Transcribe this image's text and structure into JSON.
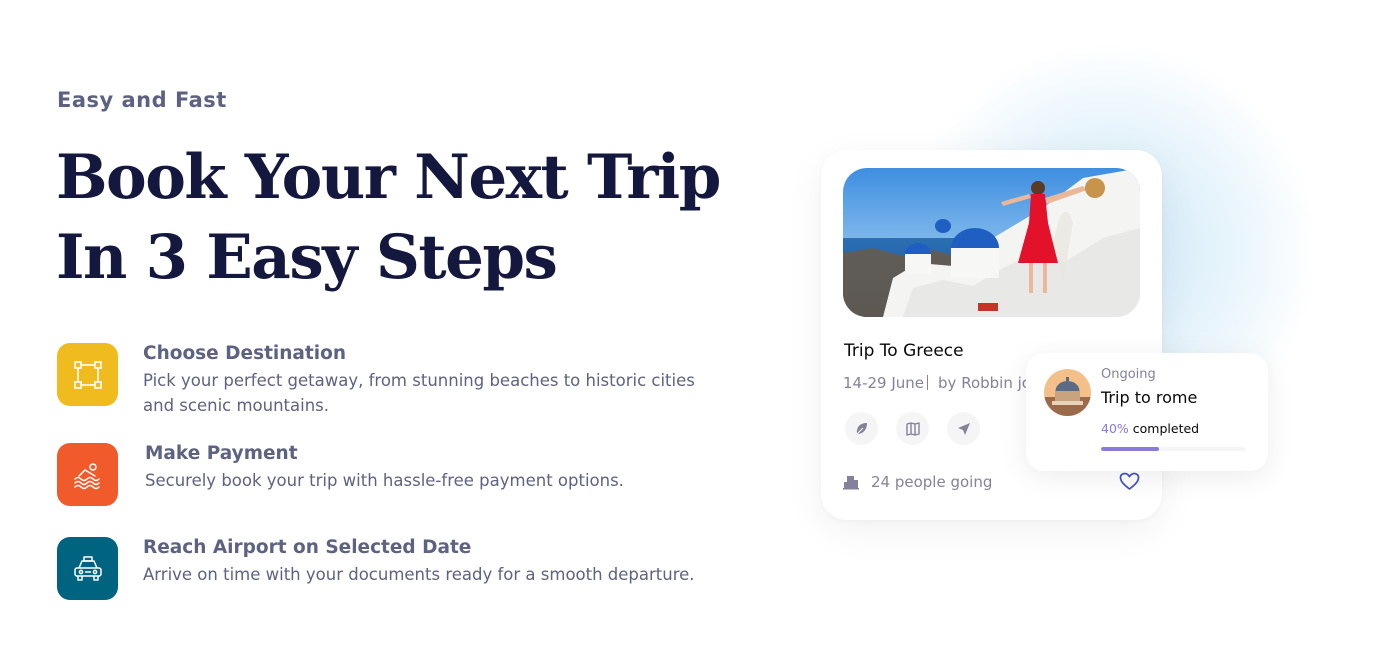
{
  "hero": {
    "eyebrow": "Easy and Fast",
    "headline_line1": "Book Your Next Trip",
    "headline_line2": "In 3 Easy Steps"
  },
  "steps": [
    {
      "icon": "selection-icon",
      "color": "#f0bb1f",
      "title": "Choose Destination",
      "description": "Pick your perfect getaway, from stunning beaches to historic cities and scenic mountains."
    },
    {
      "icon": "swimming-icon",
      "color": "#f15a2b",
      "title": "Make Payment",
      "description": "Securely book your trip with hassle-free payment options."
    },
    {
      "icon": "taxi-icon",
      "color": "#006380",
      "title": "Reach Airport on Selected Date",
      "description": "Arrive on time with your documents ready for a smooth departure."
    }
  ],
  "trip_card": {
    "title": "Trip To Greece",
    "dates": "14-29 June",
    "author": "by Robbin jo",
    "actions": [
      "leaf-icon",
      "map-icon",
      "send-icon"
    ],
    "people": "24 people going",
    "accent": "#4152ca"
  },
  "ongoing": {
    "label": "Ongoing",
    "title": "Trip to rome",
    "percent_text": "40%",
    "completed_text": " completed",
    "progress": 0.4,
    "accent": "#8a79df"
  }
}
